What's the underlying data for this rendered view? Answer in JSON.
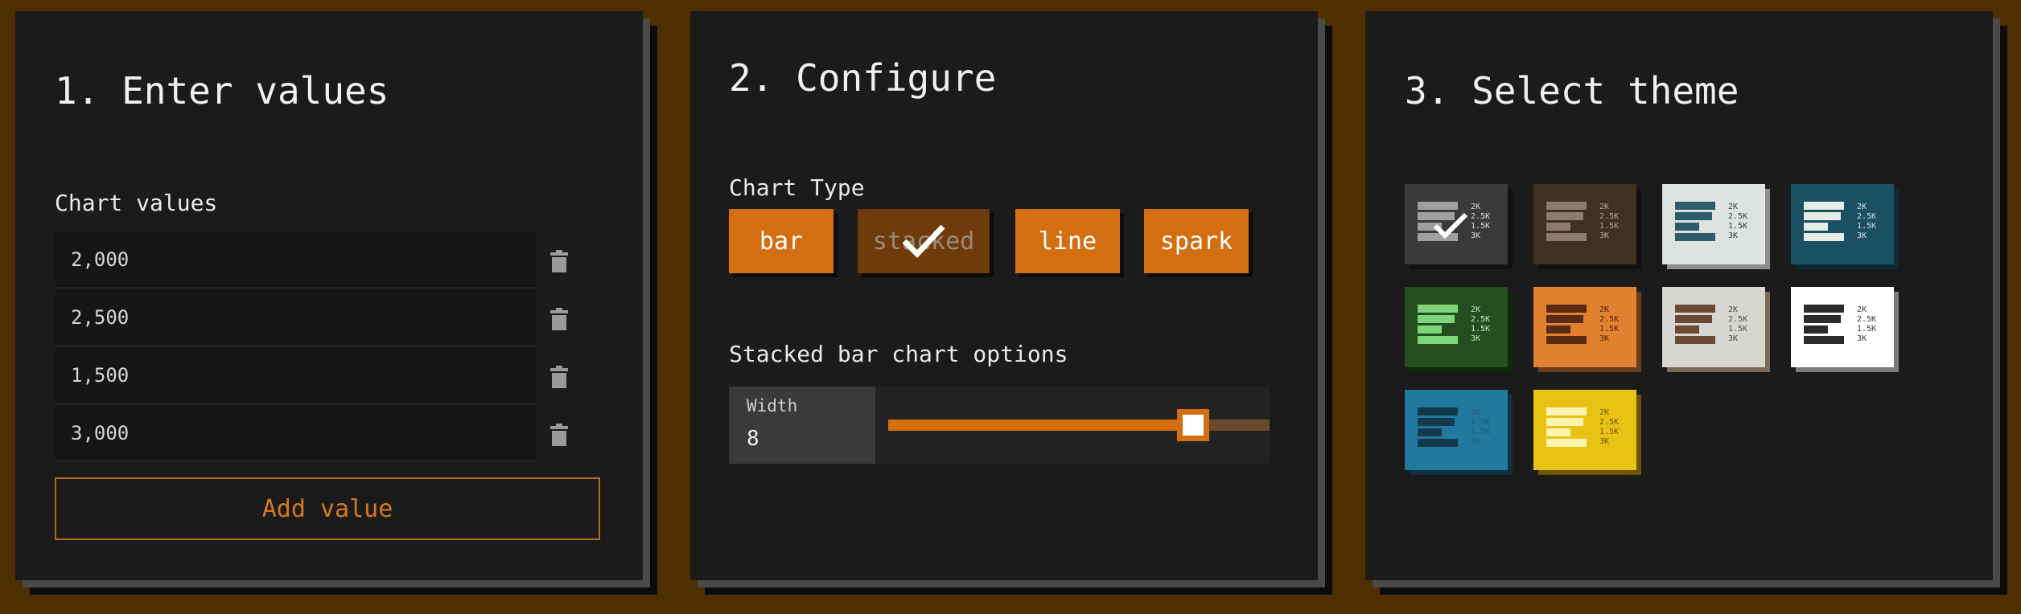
{
  "panels": {
    "enter": {
      "title": "1. Enter values",
      "values_label": "Chart values",
      "values": [
        "2,000",
        "2,500",
        "1,500",
        "3,000"
      ],
      "add_button": "Add value"
    },
    "configure": {
      "title": "2. Configure",
      "chart_type_label": "Chart Type",
      "chart_types": [
        {
          "label": "bar",
          "selected": false
        },
        {
          "label": "stacked",
          "selected": true
        },
        {
          "label": "line",
          "selected": false
        },
        {
          "label": "spark",
          "selected": false
        }
      ],
      "options_label": "Stacked bar chart options",
      "width_label": "Width",
      "width_value": "8",
      "width_slider_fraction": 0.8
    },
    "theme": {
      "title": "3. Select theme",
      "thumbnail_labels": [
        "2K",
        "2.5K",
        "1.5K",
        "3K"
      ],
      "themes": [
        {
          "name": "gray",
          "bg": "#3a3a3a",
          "bar": "#a0a0a0",
          "text": "#dcdcdc",
          "shadow": "#111111",
          "selected": true
        },
        {
          "name": "brown",
          "bg": "#3d3122",
          "bar": "#8c7c69",
          "text": "#b8a890",
          "shadow": "#111111",
          "selected": false
        },
        {
          "name": "light",
          "bg": "#dfe3df",
          "bar": "#2d5c6a",
          "text": "#3c3c3c",
          "shadow": "#8a8f8a",
          "selected": false
        },
        {
          "name": "teal",
          "bg": "#1b4f62",
          "bar": "#e5ede6",
          "text": "#d8e2dc",
          "shadow": "#0e2b35",
          "selected": false
        },
        {
          "name": "green",
          "bg": "#234f1e",
          "bar": "#7fd67a",
          "text": "#c7ecc3",
          "shadow": "#0d2a0b",
          "selected": false
        },
        {
          "name": "orange",
          "bg": "#e28230",
          "bar": "#5a2a12",
          "text": "#4a2410",
          "shadow": "#6b3c1b",
          "selected": false
        },
        {
          "name": "paper",
          "bg": "#d8d6d1",
          "bar": "#6b4a34",
          "text": "#4a4a4a",
          "shadow": "#7a6a58",
          "selected": false
        },
        {
          "name": "white",
          "bg": "#ffffff",
          "bar": "#2b2b2b",
          "text": "#3a3a3a",
          "shadow": "#7a7a7a",
          "selected": false
        },
        {
          "name": "blue",
          "bg": "#22799e",
          "bar": "#133a4a",
          "text": "#1c5a74",
          "shadow": "#0d2f3e",
          "selected": false
        },
        {
          "name": "yellow",
          "bg": "#e8c213",
          "bar": "#fff4b0",
          "text": "#6a5710",
          "shadow": "#6a5400",
          "selected": false
        }
      ]
    }
  },
  "icons": [
    "trash-icon",
    "checkmark-icon"
  ],
  "colors": {
    "accent": "#d36f11",
    "panel": "#1b1b1b",
    "background": "#4f2e00"
  }
}
